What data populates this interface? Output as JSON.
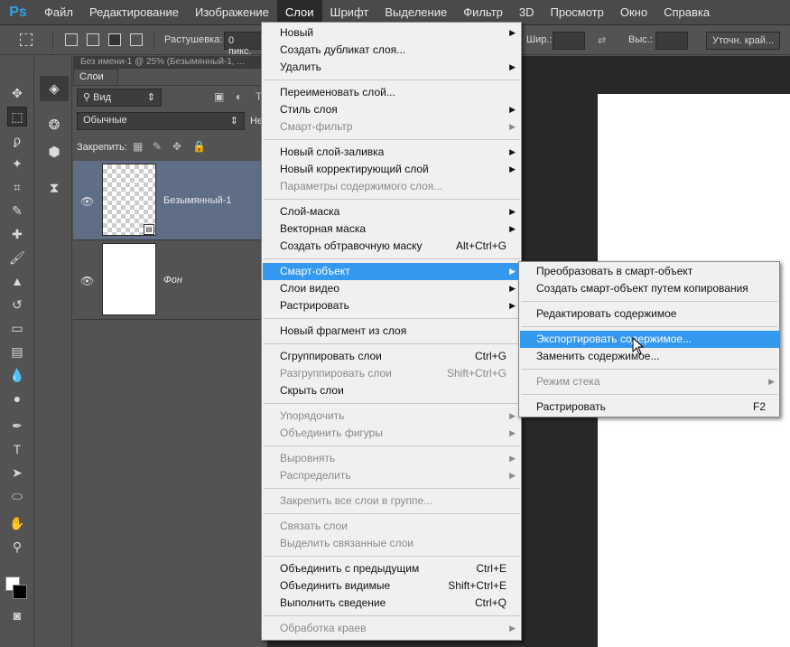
{
  "app": {
    "logo": "Ps"
  },
  "menubar": [
    "Файл",
    "Редактирование",
    "Изображение",
    "Слои",
    "Шрифт",
    "Выделение",
    "Фильтр",
    "3D",
    "Просмотр",
    "Окно",
    "Справка"
  ],
  "options": {
    "feather_label": "Растушевка:",
    "feather_value": "0 пикс.",
    "width_label": "Шир.:",
    "height_label": "Выс.:",
    "refine_button": "Уточн. край..."
  },
  "doc_tab": "Без имени-1 @ 25% (Безымянный-1, ...",
  "layers_panel": {
    "tab": "Слои",
    "filter_kind": "Вид",
    "blend_mode": "Обычные",
    "opacity_label": "Не",
    "lock_label": "Закрепить:",
    "layers": [
      {
        "name": "Безымянный-1"
      },
      {
        "name": "Фон"
      }
    ]
  },
  "layer_menu": [
    {
      "label": "Новый",
      "arrow": true
    },
    {
      "label": "Создать дубликат слоя..."
    },
    {
      "label": "Удалить",
      "arrow": true
    },
    {
      "sep": true
    },
    {
      "label": "Переименовать слой..."
    },
    {
      "label": "Стиль слоя",
      "arrow": true
    },
    {
      "label": "Смарт-фильтр",
      "disabled": true,
      "arrow": true
    },
    {
      "sep": true
    },
    {
      "label": "Новый слой-заливка",
      "arrow": true
    },
    {
      "label": "Новый корректирующий слой",
      "arrow": true
    },
    {
      "label": "Параметры содержимого слоя...",
      "disabled": true
    },
    {
      "sep": true
    },
    {
      "label": "Слой-маска",
      "arrow": true
    },
    {
      "label": "Векторная маска",
      "arrow": true
    },
    {
      "label": "Создать обтравочную маску",
      "shortcut": "Alt+Ctrl+G"
    },
    {
      "sep": true
    },
    {
      "label": "Смарт-объект",
      "arrow": true,
      "highlight": true
    },
    {
      "label": "Слои видео",
      "arrow": true
    },
    {
      "label": "Растрировать",
      "arrow": true
    },
    {
      "sep": true
    },
    {
      "label": "Новый фрагмент из слоя"
    },
    {
      "sep": true
    },
    {
      "label": "Сгруппировать слои",
      "shortcut": "Ctrl+G"
    },
    {
      "label": "Разгруппировать слои",
      "shortcut": "Shift+Ctrl+G",
      "disabled": true
    },
    {
      "label": "Скрыть слои"
    },
    {
      "sep": true
    },
    {
      "label": "Упорядочить",
      "disabled": true,
      "arrow": true
    },
    {
      "label": "Объединить фигуры",
      "disabled": true,
      "arrow": true
    },
    {
      "sep": true
    },
    {
      "label": "Выровнять",
      "disabled": true,
      "arrow": true
    },
    {
      "label": "Распределить",
      "disabled": true,
      "arrow": true
    },
    {
      "sep": true
    },
    {
      "label": "Закрепить все слои в группе...",
      "disabled": true
    },
    {
      "sep": true
    },
    {
      "label": "Связать слои",
      "disabled": true
    },
    {
      "label": "Выделить связанные слои",
      "disabled": true
    },
    {
      "sep": true
    },
    {
      "label": "Объединить с предыдущим",
      "shortcut": "Ctrl+E"
    },
    {
      "label": "Объединить видимые",
      "shortcut": "Shift+Ctrl+E"
    },
    {
      "label": "Выполнить сведение",
      "shortcut": "Ctrl+Q"
    },
    {
      "sep": true
    },
    {
      "label": "Обработка краев",
      "disabled": true,
      "arrow": true
    }
  ],
  "smart_submenu": [
    {
      "label": "Преобразовать в смарт-объект"
    },
    {
      "label": "Создать смарт-объект путем копирования"
    },
    {
      "sep": true
    },
    {
      "label": "Редактировать содержимое"
    },
    {
      "sep": true
    },
    {
      "label": "Экспортировать содержимое...",
      "highlight": true
    },
    {
      "label": "Заменить содержимое..."
    },
    {
      "sep": true
    },
    {
      "label": "Режим стека",
      "disabled": true,
      "arrow": true
    },
    {
      "sep": true
    },
    {
      "label": "Растрировать",
      "shortcut": "F2"
    }
  ],
  "colors": {
    "highlight": "#3399ee",
    "menu_bg": "#f0f0f0",
    "ui_bg": "#535353"
  }
}
